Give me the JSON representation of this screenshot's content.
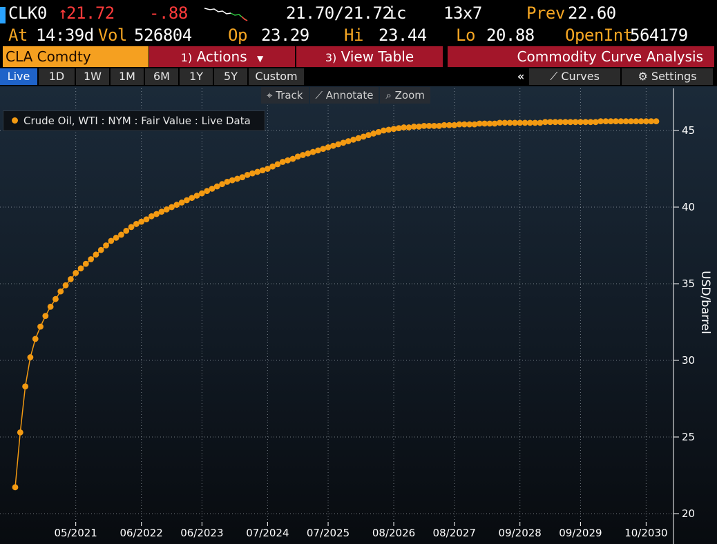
{
  "ticker": {
    "symbol": "CLK0",
    "last": "21.72",
    "change": "-.88",
    "bid_ask": "21.70/21.72",
    "bid_ask_suffix": "ic",
    "size": "13x7",
    "prev_label": "Prev",
    "prev": "22.60",
    "at_label": "At",
    "time": "14:39d",
    "vol_label": "Vol",
    "vol": "526804",
    "open_label": "Op",
    "open": "23.29",
    "hi_label": "Hi",
    "hi": "23.44",
    "lo_label": "Lo",
    "lo": "20.88",
    "oi_label": "OpenInt",
    "oi": "564179"
  },
  "function_bar": {
    "security": "CLA Comdty",
    "actions_num": "1)",
    "actions": "Actions",
    "view_num": "3)",
    "view_table": "View Table",
    "title": "Commodity Curve Analysis"
  },
  "range_tabs": [
    "Live",
    "1D",
    "1W",
    "1M",
    "6M",
    "1Y",
    "5Y",
    "Custom"
  ],
  "right_tools": {
    "collapse": "«",
    "curves": "Curves",
    "settings": "Settings"
  },
  "chart_tools": [
    "Track",
    "Annotate",
    "Zoom"
  ],
  "colors": {
    "series": "#f39a12",
    "accent": "#f5a020",
    "action_bg": "#a3162a",
    "live_tab": "#1f63c9",
    "down": "#ff3b3b"
  },
  "chart_data": {
    "type": "line",
    "title": "",
    "ylabel": "USD/barrel",
    "xlabel": "",
    "ylim": [
      20,
      46.5
    ],
    "yticks": [
      20,
      25,
      30,
      35,
      40,
      45
    ],
    "x_tick_labels": [
      "05/2021",
      "06/2022",
      "06/2023",
      "07/2024",
      "07/2025",
      "08/2026",
      "08/2027",
      "09/2028",
      "09/2029",
      "10/2030"
    ],
    "x_start": "05/2020",
    "x_end": "12/2030",
    "legend_position": "top-left",
    "grid": true,
    "series": [
      {
        "name": "Crude Oil, WTI : NYM : Fair Value : Live Data",
        "contracts": [
          "05/2020",
          "06/2020",
          "07/2020",
          "08/2020",
          "09/2020",
          "10/2020",
          "11/2020",
          "12/2020",
          "01/2021",
          "02/2021",
          "03/2021",
          "04/2021",
          "05/2021",
          "06/2021",
          "07/2021",
          "08/2021",
          "09/2021",
          "10/2021",
          "11/2021",
          "12/2021",
          "01/2022",
          "02/2022",
          "03/2022",
          "04/2022",
          "05/2022",
          "06/2022",
          "07/2022",
          "08/2022",
          "09/2022",
          "10/2022",
          "11/2022",
          "12/2022",
          "01/2023",
          "02/2023",
          "03/2023",
          "04/2023",
          "05/2023",
          "06/2023",
          "07/2023",
          "08/2023",
          "09/2023",
          "10/2023",
          "11/2023",
          "12/2023",
          "01/2024",
          "02/2024",
          "03/2024",
          "04/2024",
          "05/2024",
          "06/2024",
          "07/2024",
          "08/2024",
          "09/2024",
          "10/2024",
          "11/2024",
          "12/2024",
          "01/2025",
          "02/2025",
          "03/2025",
          "04/2025",
          "05/2025",
          "06/2025",
          "07/2025",
          "08/2025",
          "09/2025",
          "10/2025",
          "11/2025",
          "12/2025",
          "01/2026",
          "02/2026",
          "03/2026",
          "04/2026",
          "05/2026",
          "06/2026",
          "07/2026",
          "08/2026",
          "09/2026",
          "10/2026",
          "11/2026",
          "12/2026",
          "01/2027",
          "02/2027",
          "03/2027",
          "04/2027",
          "05/2027",
          "06/2027",
          "07/2027",
          "08/2027",
          "09/2027",
          "10/2027",
          "11/2027",
          "12/2027",
          "01/2028",
          "02/2028",
          "03/2028",
          "04/2028",
          "05/2028",
          "06/2028",
          "07/2028",
          "08/2028",
          "09/2028",
          "10/2028",
          "11/2028",
          "12/2028",
          "01/2029",
          "02/2029",
          "03/2029",
          "04/2029",
          "05/2029",
          "06/2029",
          "07/2029",
          "08/2029",
          "09/2029",
          "10/2029",
          "11/2029",
          "12/2029",
          "01/2030",
          "02/2030",
          "03/2030",
          "04/2030",
          "05/2030",
          "06/2030",
          "07/2030",
          "08/2030",
          "09/2030",
          "10/2030",
          "11/2030",
          "12/2030"
        ],
        "values": [
          21.72,
          25.3,
          28.3,
          30.2,
          31.4,
          32.2,
          32.9,
          33.5,
          34.0,
          34.5,
          34.9,
          35.3,
          35.7,
          36.0,
          36.3,
          36.6,
          36.9,
          37.2,
          37.5,
          37.8,
          38.0,
          38.2,
          38.45,
          38.7,
          38.9,
          39.05,
          39.2,
          39.4,
          39.55,
          39.7,
          39.85,
          40.0,
          40.15,
          40.3,
          40.45,
          40.6,
          40.75,
          40.9,
          41.05,
          41.2,
          41.35,
          41.5,
          41.65,
          41.75,
          41.85,
          41.95,
          42.1,
          42.2,
          42.3,
          42.4,
          42.5,
          42.65,
          42.8,
          42.95,
          43.05,
          43.15,
          43.3,
          43.4,
          43.5,
          43.6,
          43.7,
          43.8,
          43.9,
          44.0,
          44.1,
          44.2,
          44.3,
          44.4,
          44.5,
          44.6,
          44.7,
          44.8,
          44.9,
          45.0,
          45.05,
          45.1,
          45.15,
          45.2,
          45.2,
          45.25,
          45.25,
          45.3,
          45.3,
          45.3,
          45.3,
          45.35,
          45.35,
          45.35,
          45.4,
          45.4,
          45.4,
          45.4,
          45.45,
          45.45,
          45.45,
          45.45,
          45.5,
          45.5,
          45.5,
          45.5,
          45.5,
          45.5,
          45.5,
          45.5,
          45.5,
          45.55,
          45.55,
          45.55,
          45.55,
          45.55,
          45.55,
          45.55,
          45.55,
          45.55,
          45.55,
          45.55,
          45.6,
          45.6,
          45.6,
          45.6,
          45.6,
          45.6,
          45.6,
          45.6,
          45.6,
          45.6,
          45.6,
          45.6
        ]
      }
    ]
  }
}
